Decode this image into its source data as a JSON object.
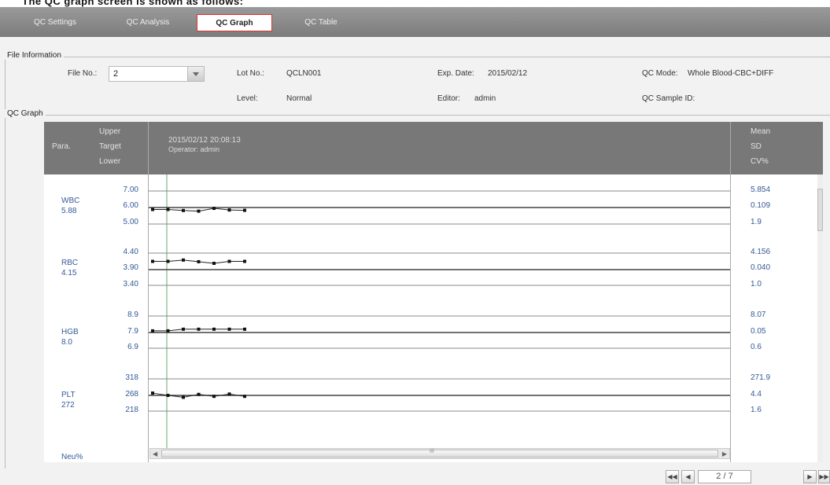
{
  "header": {
    "title": "The QC graph screen is shown as follows:"
  },
  "tabs": [
    {
      "label": "QC Settings",
      "active": false
    },
    {
      "label": "QC Analysis",
      "active": false
    },
    {
      "label": "QC Graph",
      "active": true
    },
    {
      "label": "QC Table",
      "active": false
    }
  ],
  "file_info": {
    "legend": "File Information",
    "file_no_label": "File No.:",
    "file_no_value": "2",
    "lot_no_label": "Lot No.:",
    "lot_no_value": "QCLN001",
    "level_label": "Level:",
    "level_value": "Normal",
    "exp_date_label": "Exp. Date:",
    "exp_date_value": "2015/02/12",
    "editor_label": "Editor:",
    "editor_value": "admin",
    "qc_mode_label": "QC Mode:",
    "qc_mode_value": "Whole Blood-CBC+DIFF",
    "qc_sample_id_label": "QC Sample ID:",
    "qc_sample_id_value": ""
  },
  "graph": {
    "legend": "QC Graph",
    "head": {
      "para": "Para.",
      "upper": "Upper",
      "target": "Target",
      "lower": "Lower",
      "datetime": "2015/02/12 20:08:13",
      "operator": "Operator:   admin",
      "mean": "Mean",
      "sd": "SD",
      "cv": "CV%"
    },
    "params": [
      {
        "name": "WBC",
        "value": "5.88",
        "upper": "7.00",
        "target": "6.00",
        "lower": "5.00",
        "mean": "5.854",
        "sd": "0.109",
        "cv": "1.9"
      },
      {
        "name": "RBC",
        "value": "4.15",
        "upper": "4.40",
        "target": "3.90",
        "lower": "3.40",
        "mean": "4.156",
        "sd": "0.040",
        "cv": "1.0"
      },
      {
        "name": "HGB",
        "value": "8.0",
        "upper": "8.9",
        "target": "7.9",
        "lower": "6.9",
        "mean": "8.07",
        "sd": "0.05",
        "cv": "0.6"
      },
      {
        "name": "PLT",
        "value": "272",
        "upper": "318",
        "target": "268",
        "lower": "218",
        "mean": "271.9",
        "sd": "4.4",
        "cv": "1.6"
      },
      {
        "name": "Neu%",
        "value": ""
      }
    ],
    "series": [
      {
        "values": [
          5.88,
          5.88,
          5.82,
          5.78,
          5.95,
          5.85,
          5.83
        ]
      },
      {
        "values": [
          4.15,
          4.15,
          4.19,
          4.14,
          4.09,
          4.15,
          4.15
        ]
      },
      {
        "values": [
          8.0,
          8.0,
          8.1,
          8.1,
          8.1,
          8.1,
          8.1
        ]
      },
      {
        "values": [
          275,
          268,
          262,
          271,
          265,
          272,
          265
        ]
      }
    ],
    "scroll_mid": "III"
  },
  "pager": {
    "text": "2  /  7",
    "first": "◀◀",
    "prev": "◀",
    "next": "▶",
    "last": "▶▶"
  }
}
